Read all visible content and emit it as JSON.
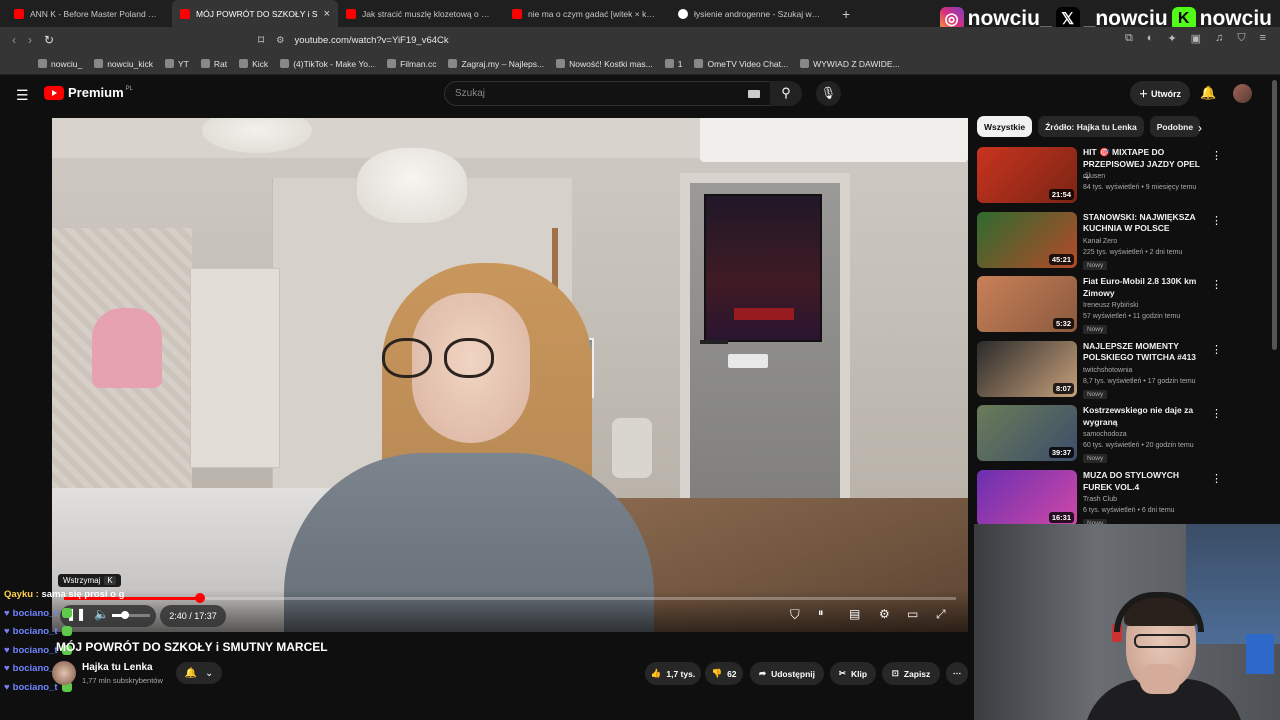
{
  "tabs": [
    {
      "title": "ANN K - Before Master Poland DJ Bat",
      "active": false,
      "fav": "youtube"
    },
    {
      "title": "MÓJ POWRÓT DO SZKOŁY i S",
      "active": true,
      "fav": "youtube"
    },
    {
      "title": "Jak stracić muszlę klozetową o półno",
      "active": false,
      "fav": "youtube"
    },
    {
      "title": "nie ma o czym gadać [witek × kasix o",
      "active": false,
      "fav": "youtube"
    },
    {
      "title": "łysienie androgenne - Szukaj w Goog",
      "active": false,
      "fav": "google"
    }
  ],
  "socials": {
    "instagram": "nowciu_",
    "x": "_nowciu",
    "kick": "nowciu"
  },
  "address": {
    "url": "youtube.com/watch?v=YiF19_v64Ck"
  },
  "bookmarks": [
    "nowciu_",
    "nowciu_kick",
    "YT",
    "Rat",
    "Kick",
    "(4)TikTok - Make Yo...",
    "Filman.cc",
    "Zagraj.my – Najleps...",
    "Nowość! Kostki mas...",
    "1",
    "OmeTV Video Chat...",
    "WYWIAD Z DAWIDE..."
  ],
  "yt": {
    "logo": "Premium",
    "region": "PL",
    "search_placeholder": "Szukaj",
    "create_label": "Utwórz"
  },
  "player": {
    "tooltip": "Wstrzymaj",
    "tooltip_key": "K",
    "time": "2:40 / 17:37",
    "progress": 0.152,
    "volume": 0.35
  },
  "chat": [
    {
      "user": "Qayku :",
      "text": "sama się prosi o gwałt",
      "style": "u1"
    },
    {
      "user": "bociano_t",
      "text": "",
      "style": "u"
    },
    {
      "user": "bociano_t",
      "text": "",
      "style": "u"
    },
    {
      "user": "bociano_t",
      "text": "",
      "style": "u"
    },
    {
      "user": "bociano_t",
      "text": "",
      "style": "u"
    },
    {
      "user": "bociano_t",
      "text": "",
      "style": "u"
    }
  ],
  "video": {
    "title": "MÓJ POWRÓT DO SZKOŁY i SMUTNY MARCEL",
    "channel": "Hajka tu Lenka",
    "subscribers": "1,77 mln subskrybentów",
    "likes": "1,7 tys.",
    "dislikes": "62",
    "share": "Udostępnij",
    "clip": "Klip",
    "save": "Zapisz"
  },
  "chips": [
    "Wszystkie",
    "Źródło: Hajka tu Lenka",
    "Podobne"
  ],
  "recommendations": [
    {
      "title": "HIT 🎯 MIXTAPE DO PRZEPISOWEJ JAZDY OPEL ...",
      "channel": "djlusen",
      "meta": "84 tys. wyświetleń • 9 miesięcy temu",
      "duration": "21:54",
      "badge": "",
      "color1": "#c9341f",
      "color2": "#7a2414",
      "upper": true
    },
    {
      "title": "STANOWSKI: NAJWIĘKSZA KUCHNIA W POLSCE",
      "channel": "Kanał Zero",
      "meta": "225 tys. wyświetleń • 2 dni temu",
      "duration": "45:21",
      "badge": "Nowy",
      "color1": "#2e6b2e",
      "color2": "#b54a2a",
      "upper": true
    },
    {
      "title": "Fiat Euro-Mobil 2.8 130K km Zimowy",
      "channel": "Ireneusz Rybiński",
      "meta": "57 wyświetleń • 11 godzin temu",
      "duration": "5:32",
      "badge": "Nowy",
      "color1": "#c98058",
      "color2": "#8a5a3e",
      "upper": false
    },
    {
      "title": "NAJLEPSZE MOMENTY POLSKIEGO TWITCHA #413",
      "channel": "twitchshotownia",
      "meta": "8,7 tys. wyświetleń • 17 godzin temu",
      "duration": "8:07",
      "badge": "Nowy",
      "color1": "#2b2b2b",
      "color2": "#c7a07a",
      "upper": true
    },
    {
      "title": "Kostrzewskiego nie daje za wygraną",
      "channel": "samochodoza",
      "meta": "60 tys. wyświetleń • 20 godzin temu",
      "duration": "39:37",
      "badge": "Nowy",
      "color1": "#6a7c58",
      "color2": "#3d4d6a",
      "upper": false
    },
    {
      "title": "MUZA DO STYLOWYCH FUREK VOL.4",
      "channel": "Trash Club",
      "meta": "6 tys. wyświetleń • 6 dni temu",
      "duration": "16:31",
      "badge": "Nowy",
      "color1": "#6a2fb0",
      "color2": "#d048a8",
      "upper": true
    }
  ]
}
